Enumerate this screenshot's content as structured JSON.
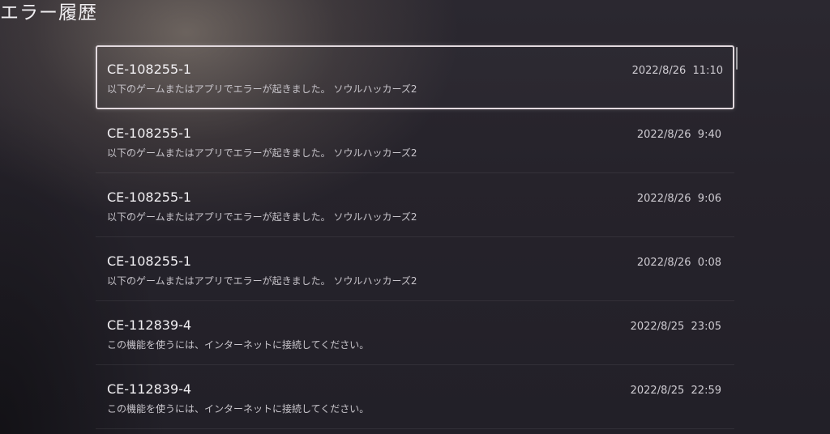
{
  "page": {
    "title": "エラー履歴"
  },
  "errors": [
    {
      "code": "CE-108255-1",
      "message": "以下のゲームまたはアプリでエラーが起きました。 ソウルハッカーズ2",
      "datetime": "2022/8/26  11:10",
      "focused": true
    },
    {
      "code": "CE-108255-1",
      "message": "以下のゲームまたはアプリでエラーが起きました。 ソウルハッカーズ2",
      "datetime": "2022/8/26  9:40",
      "focused": false
    },
    {
      "code": "CE-108255-1",
      "message": "以下のゲームまたはアプリでエラーが起きました。 ソウルハッカーズ2",
      "datetime": "2022/8/26  9:06",
      "focused": false
    },
    {
      "code": "CE-108255-1",
      "message": "以下のゲームまたはアプリでエラーが起きました。 ソウルハッカーズ2",
      "datetime": "2022/8/26  0:08",
      "focused": false
    },
    {
      "code": "CE-112839-4",
      "message": "この機能を使うには、インターネットに接続してください。",
      "datetime": "2022/8/25  23:05",
      "focused": false
    },
    {
      "code": "CE-112839-4",
      "message": "この機能を使うには、インターネットに接続してください。",
      "datetime": "2022/8/25  22:59",
      "focused": false
    }
  ],
  "colors": {
    "background": "#26232b",
    "focus_border": "#e2d9de",
    "primary_text": "#f2f0f3",
    "secondary_text": "#c9c6cc"
  }
}
